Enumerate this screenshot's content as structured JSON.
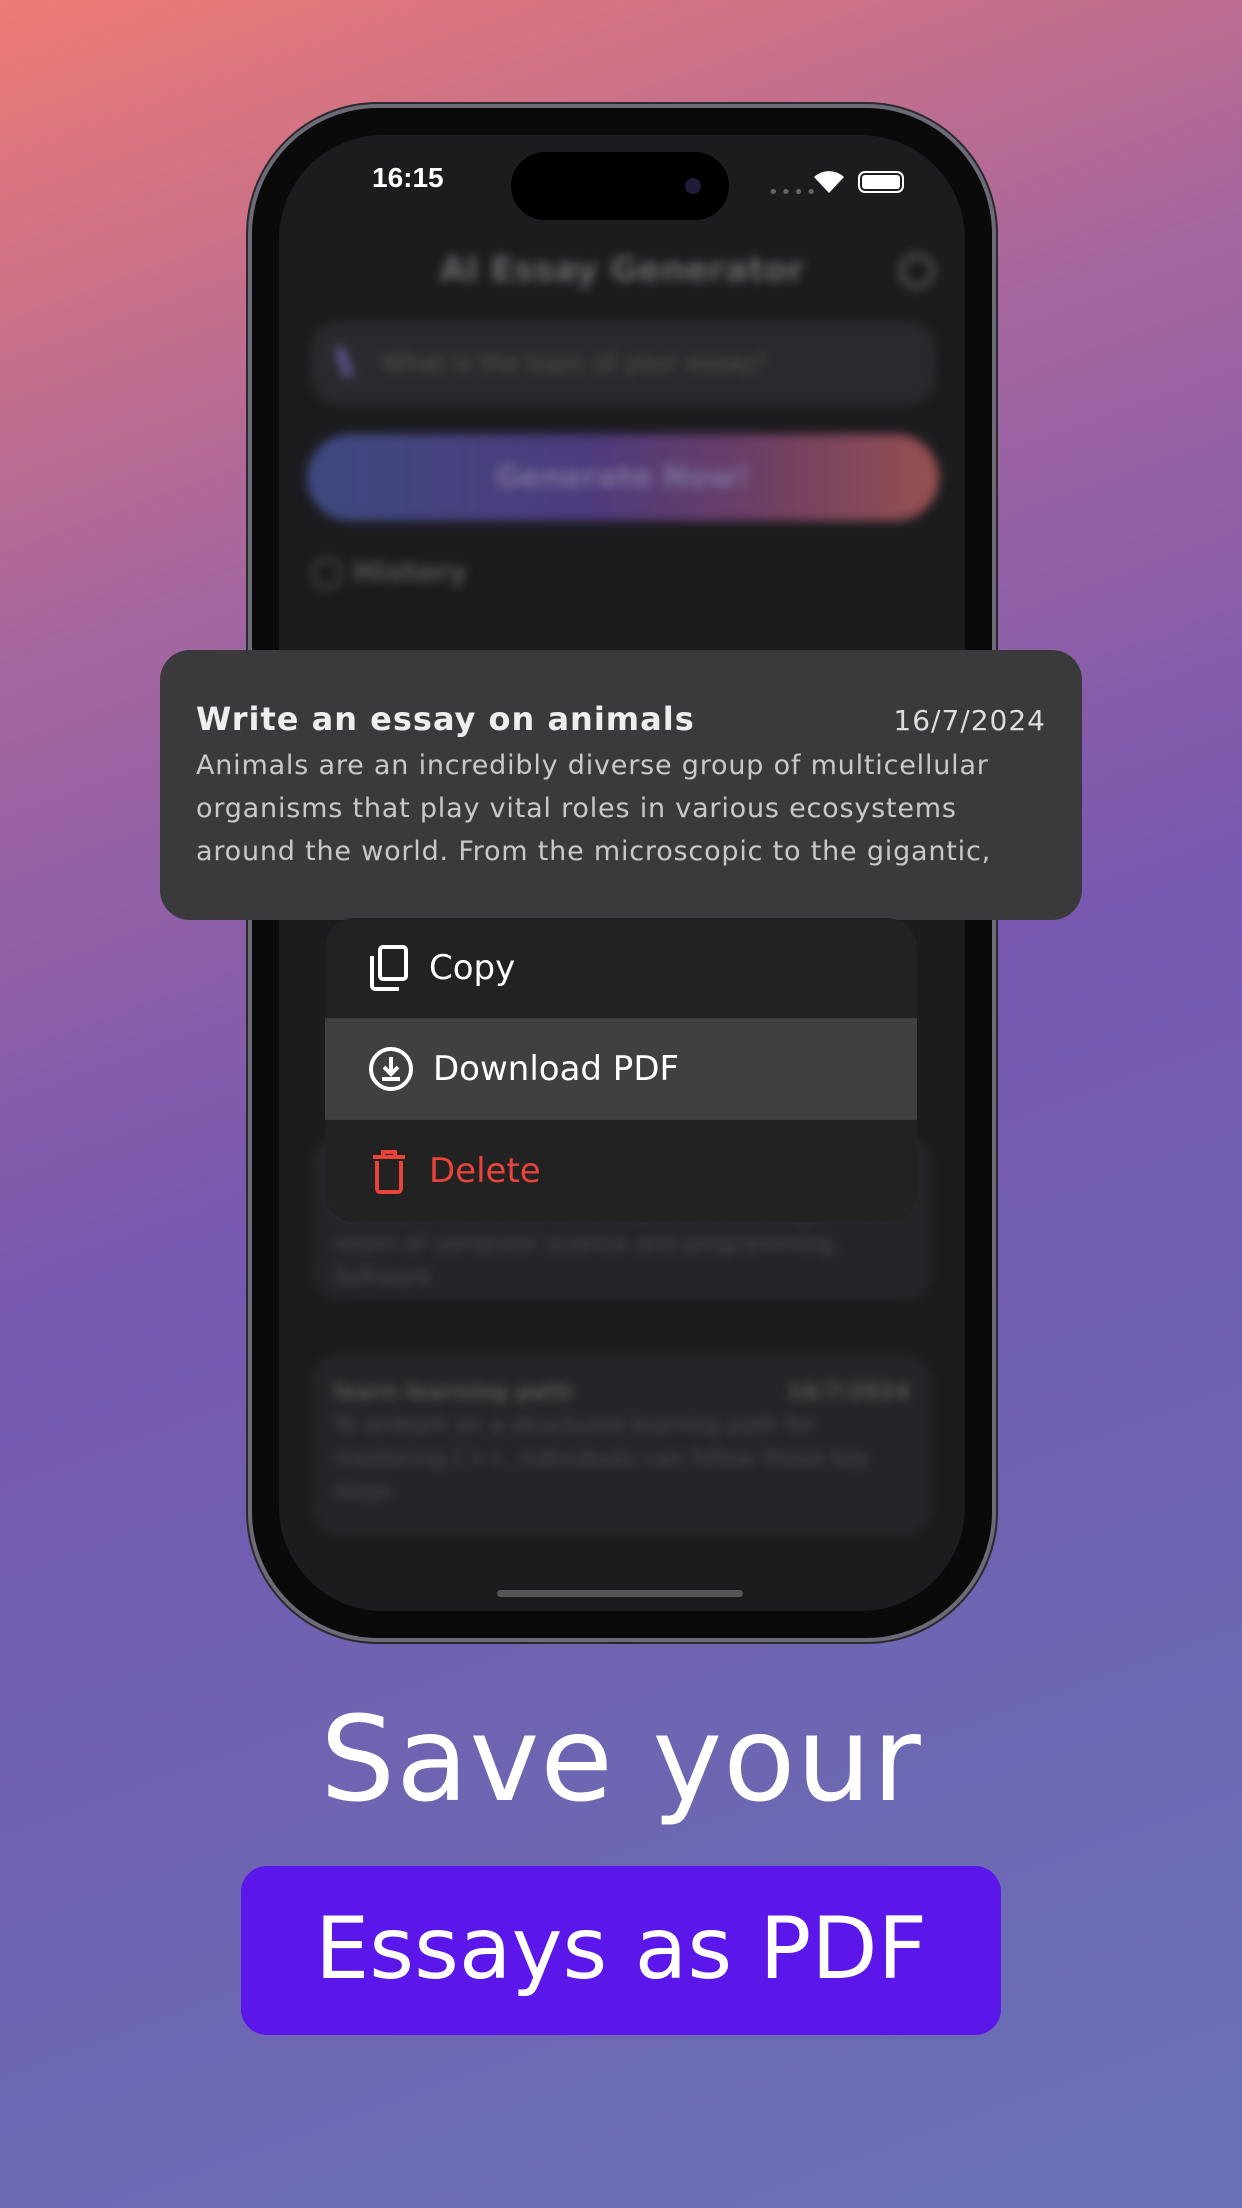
{
  "status_bar": {
    "time": "16:15"
  },
  "app": {
    "title": "AI Essay Generator",
    "input_placeholder": "What is the topic of your essay?",
    "generate_label": "Generate Now!",
    "history_label": "History"
  },
  "background_cards": [
    {
      "title": "",
      "date": "",
      "body": "Software is at once an entity and knowledge in the realm of computer science and programming. Software"
    },
    {
      "title": "learn learning path",
      "date": "16/7/2024",
      "body": "To embark on a structured learning path for mastering C++, individuals can follow these key steps"
    }
  ],
  "selected_card": {
    "title": "Write an essay on animals",
    "date": "16/7/2024",
    "body": "Animals are an incredibly diverse group of multicellular organisms that play vital roles in various ecosystems around the world. From the microscopic to the gigantic,"
  },
  "context_menu": [
    {
      "label": "Copy",
      "icon": "copy-icon"
    },
    {
      "label": "Download PDF",
      "icon": "download-icon",
      "highlighted": true
    },
    {
      "label": "Delete",
      "icon": "trash-icon",
      "destructive": true,
      "color": "#e8443a"
    }
  ],
  "promo": {
    "headline": "Save your",
    "highlight": "Essays as PDF",
    "highlight_color": "#5b16ea"
  }
}
